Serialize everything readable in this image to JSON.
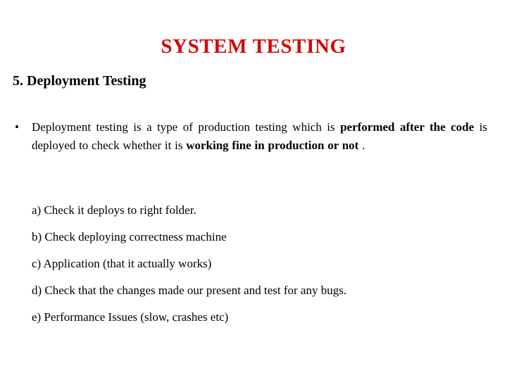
{
  "slide": {
    "title": "SYSTEM TESTING",
    "title_color": "#d60606",
    "background_color": "#ffffff",
    "text_color": "#000000",
    "sub_heading": "5. Deployment Testing",
    "bullet_marker": "•"
  },
  "bullet": {
    "runs": [
      {
        "text": "Deployment testing is a type of production testing which is ",
        "bold": false
      },
      {
        "text": "performed after the code ",
        "bold": true
      },
      {
        "text": "is deployed to check whether it is ",
        "bold": false
      },
      {
        "text": "working fine in production or not",
        "bold": true
      },
      {
        "text": " .",
        "bold": false
      }
    ],
    "full_text": "Deployment testing is a type of production testing which is performed after the code is deployed to check whether it is working fine in production or not ."
  },
  "sub_items": [
    {
      "label": "a) Check it deploys to right folder."
    },
    {
      "label": "b) Check deploying correctness machine"
    },
    {
      "label": "c) Application (that it actually works)"
    },
    {
      "label": "d) Check that the changes made our present and test for any bugs."
    },
    {
      "label": "e) Performance Issues (slow, crashes etc)"
    }
  ]
}
